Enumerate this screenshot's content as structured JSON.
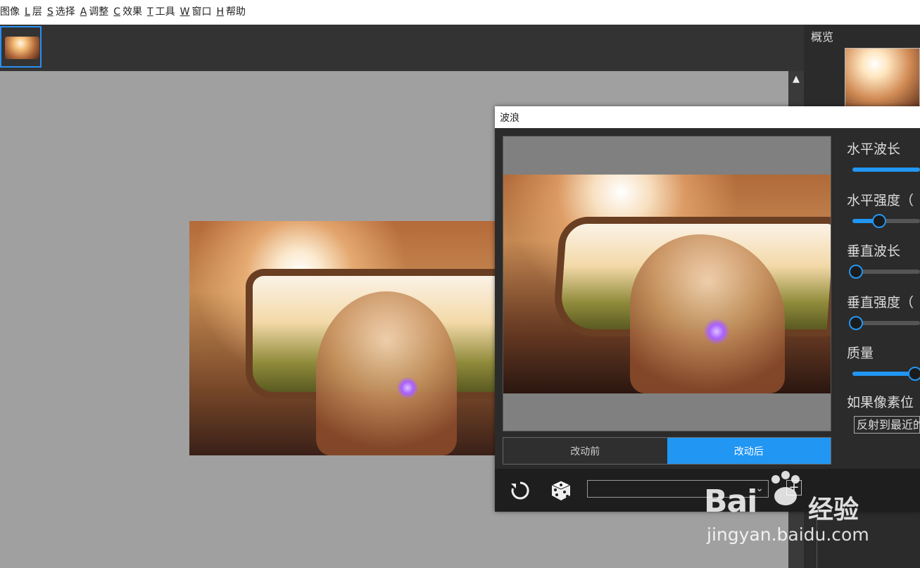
{
  "menu": [
    {
      "key": "",
      "label": "图像"
    },
    {
      "key": "L",
      "label": "层"
    },
    {
      "key": "S",
      "label": "选择"
    },
    {
      "key": "A",
      "label": "调整"
    },
    {
      "key": "C",
      "label": "效果"
    },
    {
      "key": "T",
      "label": "工具"
    },
    {
      "key": "W",
      "label": "窗口"
    },
    {
      "key": "H",
      "label": "帮助"
    }
  ],
  "right_panel": {
    "title": "概览"
  },
  "dialog": {
    "title": "波浪",
    "toggle": {
      "before": "改动前",
      "after": "改动后",
      "active": "after"
    },
    "params": [
      {
        "label": "水平波长",
        "value": 1.0
      },
      {
        "label": "水平强度（",
        "value": 0.4
      },
      {
        "label": "垂直波长",
        "value": 0.05
      },
      {
        "label": "垂直强度（",
        "value": 0.05
      },
      {
        "label": "质量",
        "value": 0.93
      }
    ],
    "edge_label": "如果像素位",
    "edge_select": "反射到最近的",
    "preset_value": ""
  },
  "watermark": {
    "logo": "Bai",
    "logo_suffix": "经验",
    "url": "jingyan.baidu.com"
  },
  "colors": {
    "accent": "#2196f3",
    "panel_bg": "#2b2b2b",
    "canvas_bg": "#a0a0a0"
  }
}
